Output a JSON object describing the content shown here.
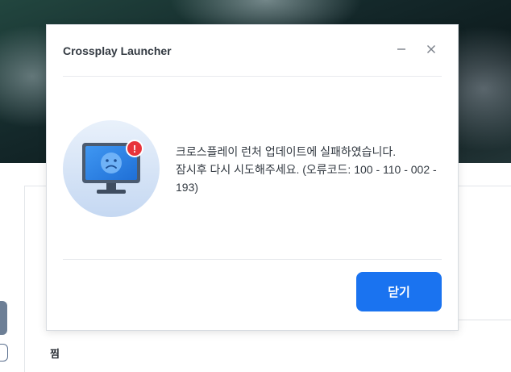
{
  "dialog": {
    "title": "Crossplay Launcher",
    "message_line1": "크로스플레이 런처 업데이트에 실패하였습니다.",
    "message_line2": "잠시후 다시 시도해주세요. (오류코드: 100 - 110 - 002 - 193)",
    "close_button_label": "닫기",
    "minimize_icon": "minimize-icon",
    "close_icon": "close-icon",
    "illustration_icon": "error-monitor-icon",
    "badge_text": "!"
  },
  "background": {
    "partial_text": "찜"
  },
  "colors": {
    "accent": "#1a73f0",
    "error_badge": "#e8333a",
    "monitor_screen": "#2f86e8"
  }
}
